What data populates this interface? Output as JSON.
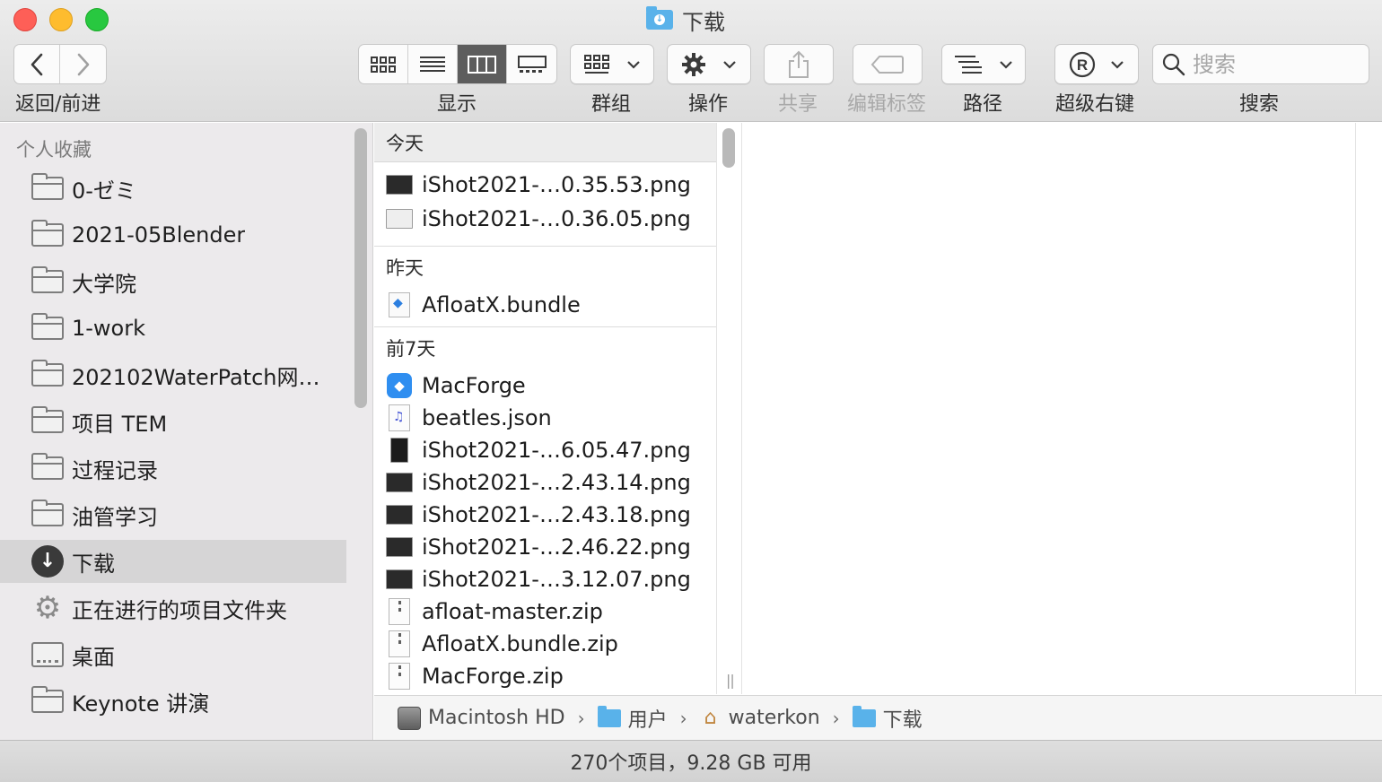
{
  "window": {
    "title": "下载"
  },
  "toolbar": {
    "nav_label": "返回/前进",
    "view_label": "显示",
    "group_label": "群组",
    "action_label": "操作",
    "share_label": "共享",
    "tags_label": "编辑标签",
    "path_label": "路径",
    "superright_label": "超级右键",
    "search_label": "搜索",
    "search_placeholder": "搜索",
    "view_mode_selected": "columns"
  },
  "sidebar": {
    "header": "个人收藏",
    "items": [
      {
        "label": "0-ゼミ",
        "icon": "folder-icon"
      },
      {
        "label": "2021-05Blender",
        "icon": "folder-icon"
      },
      {
        "label": "大学院",
        "icon": "folder-icon"
      },
      {
        "label": "1-work",
        "icon": "folder-icon"
      },
      {
        "label": "202102WaterPatch网…",
        "icon": "folder-icon"
      },
      {
        "label": "项目 TEM",
        "icon": "folder-icon"
      },
      {
        "label": "过程记录",
        "icon": "folder-icon"
      },
      {
        "label": "油管学习",
        "icon": "folder-icon"
      },
      {
        "label": "下载",
        "icon": "download-icon",
        "selected": true
      },
      {
        "label": "正在进行的项目文件夹",
        "icon": "gear-icon"
      },
      {
        "label": "桌面",
        "icon": "desktop-icon"
      },
      {
        "label": "Keynote 讲演",
        "icon": "folder-icon"
      }
    ]
  },
  "groups": {
    "today": {
      "title": "今天",
      "files": [
        "iShot2021-…0.35.53.png",
        "iShot2021-…0.36.05.png"
      ]
    },
    "yesterday": {
      "title": "昨天",
      "files": [
        "AfloatX.bundle"
      ]
    },
    "last7": {
      "title": "前7天",
      "files": [
        "MacForge",
        "beatles.json",
        "iShot2021-…6.05.47.png",
        "iShot2021-…2.43.14.png",
        "iShot2021-…2.43.18.png",
        "iShot2021-…2.46.22.png",
        "iShot2021-…3.12.07.png",
        "afloat-master.zip",
        "AfloatX.bundle.zip",
        "MacForge.zip"
      ]
    }
  },
  "pathbar": {
    "crumbs": [
      "Macintosh HD",
      "用户",
      "waterkon",
      "下载"
    ]
  },
  "status": {
    "text": "270个项目，9.28 GB 可用"
  },
  "colors": {
    "folder_blue": "#59b2ea",
    "close": "#fe5f57",
    "minimize": "#febc2e",
    "maximize": "#28c840",
    "selection": "#d6d5d6"
  }
}
